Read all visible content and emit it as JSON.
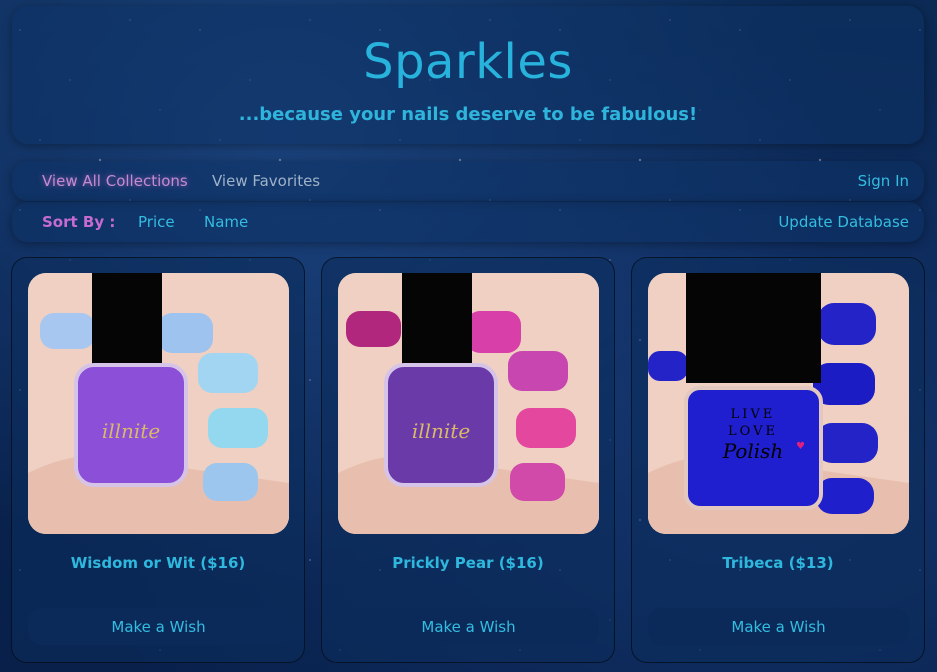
{
  "header": {
    "title": "Sparkles",
    "subtitle": "...because your nails deserve to be fabulous!"
  },
  "nav": {
    "all_collections": "View All Collections",
    "favorites": "View Favorites",
    "sign_in": "Sign In"
  },
  "sort": {
    "label": "Sort By :",
    "price": "Price",
    "name": "Name",
    "update_db": "Update Database"
  },
  "products": [
    {
      "name": "Wisdom or Wit ($16)",
      "button": "Make a Wish",
      "polish_color": "#8b4fd8",
      "nail_color": "#8fd3f0"
    },
    {
      "name": "Prickly Pear ($16)",
      "button": "Make a Wish",
      "polish_color": "#6a3aa8",
      "nail_color": "#d93fa8"
    },
    {
      "name": "Tribeca ($13)",
      "button": "Make a Wish",
      "polish_color": "#1f1fd0",
      "nail_color": "#2323c8"
    }
  ],
  "colors": {
    "accent": "#27b3dc",
    "highlight": "#c56bd2"
  }
}
